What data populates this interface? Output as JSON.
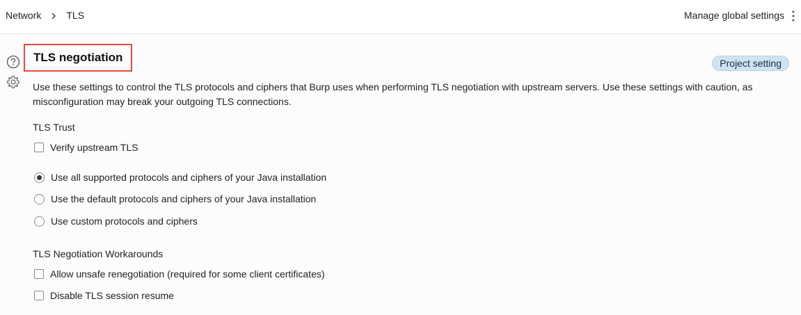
{
  "breadcrumb": {
    "items": [
      "Network",
      "TLS"
    ]
  },
  "header": {
    "manage_label": "Manage global settings"
  },
  "section": {
    "title": "TLS negotiation",
    "badge": "Project setting",
    "description": "Use these settings to control the TLS protocols and ciphers that Burp uses when performing TLS negotiation with upstream servers. Use these settings with caution, as misconfiguration may break your outgoing TLS connections."
  },
  "trust": {
    "label": "TLS Trust",
    "verify_upstream": {
      "label": "Verify upstream TLS",
      "checked": false
    }
  },
  "protocols": {
    "options": [
      {
        "label": "Use all supported protocols and ciphers of your Java installation",
        "checked": true
      },
      {
        "label": "Use the default protocols and ciphers of your Java installation",
        "checked": false
      },
      {
        "label": "Use custom protocols and ciphers",
        "checked": false
      }
    ]
  },
  "workarounds": {
    "label": "TLS Negotiation Workarounds",
    "options": [
      {
        "label": "Allow unsafe renegotiation (required for some client certificates)",
        "checked": false
      },
      {
        "label": "Disable TLS session resume",
        "checked": false
      }
    ]
  },
  "colors": {
    "highlight_border": "#e34b3b",
    "badge_bg": "#cfe3f3"
  },
  "icons": {
    "help": "help-circle-icon",
    "settings": "gear-icon",
    "separator": "chevron-right-icon",
    "menu": "kebab-menu-icon"
  }
}
